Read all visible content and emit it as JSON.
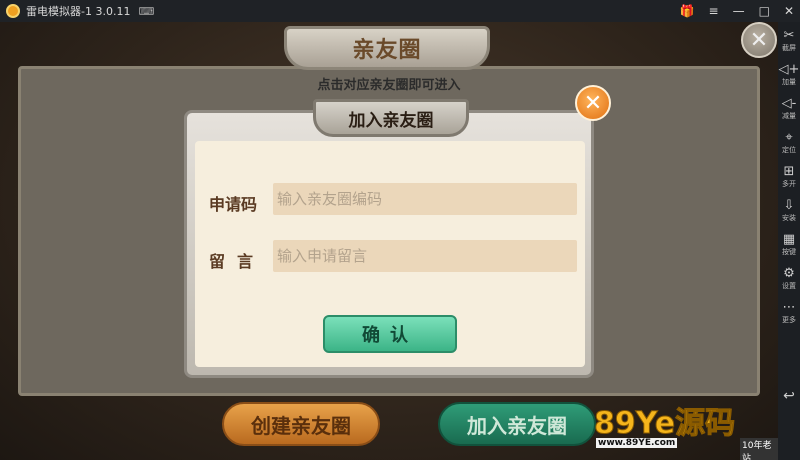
{
  "titlebar": {
    "title": "雷电模拟器-1 3.0.11",
    "gamepad_icon": "⌨",
    "gift_icon": "🎁",
    "menu_icon": "≡",
    "minimize_icon": "—",
    "maximize_icon": "□",
    "close_icon": "✕"
  },
  "sidebar": {
    "items": [
      {
        "label": "截屏",
        "icon": "✂"
      },
      {
        "label": "加量",
        "icon": "◁+"
      },
      {
        "label": "减量",
        "icon": "◁-"
      },
      {
        "label": "定位",
        "icon": "⌖"
      },
      {
        "label": "多开",
        "icon": "⊞"
      },
      {
        "label": "安装",
        "icon": "⇩"
      },
      {
        "label": "按键",
        "icon": "▦"
      },
      {
        "label": "设置",
        "icon": "⚙"
      },
      {
        "label": "更多",
        "icon": "⋯"
      }
    ],
    "back_icon": "↩"
  },
  "game": {
    "screen_title": "亲友圈",
    "hint": "点击对应亲友圈即可进入",
    "outer_close": "✕",
    "create_button": "创建亲友圈",
    "join_button": "加入亲友圈"
  },
  "dialog": {
    "title": "加入亲友圈",
    "close": "✕",
    "code_label": "申请码",
    "code_placeholder": "输入亲友圈编码",
    "message_label": "留言",
    "message_placeholder": "输入申请留言",
    "confirm_label": "确认"
  },
  "watermark": {
    "main": "89Ye源码",
    "url": "www.89YE.com",
    "tag": "10年老站"
  }
}
